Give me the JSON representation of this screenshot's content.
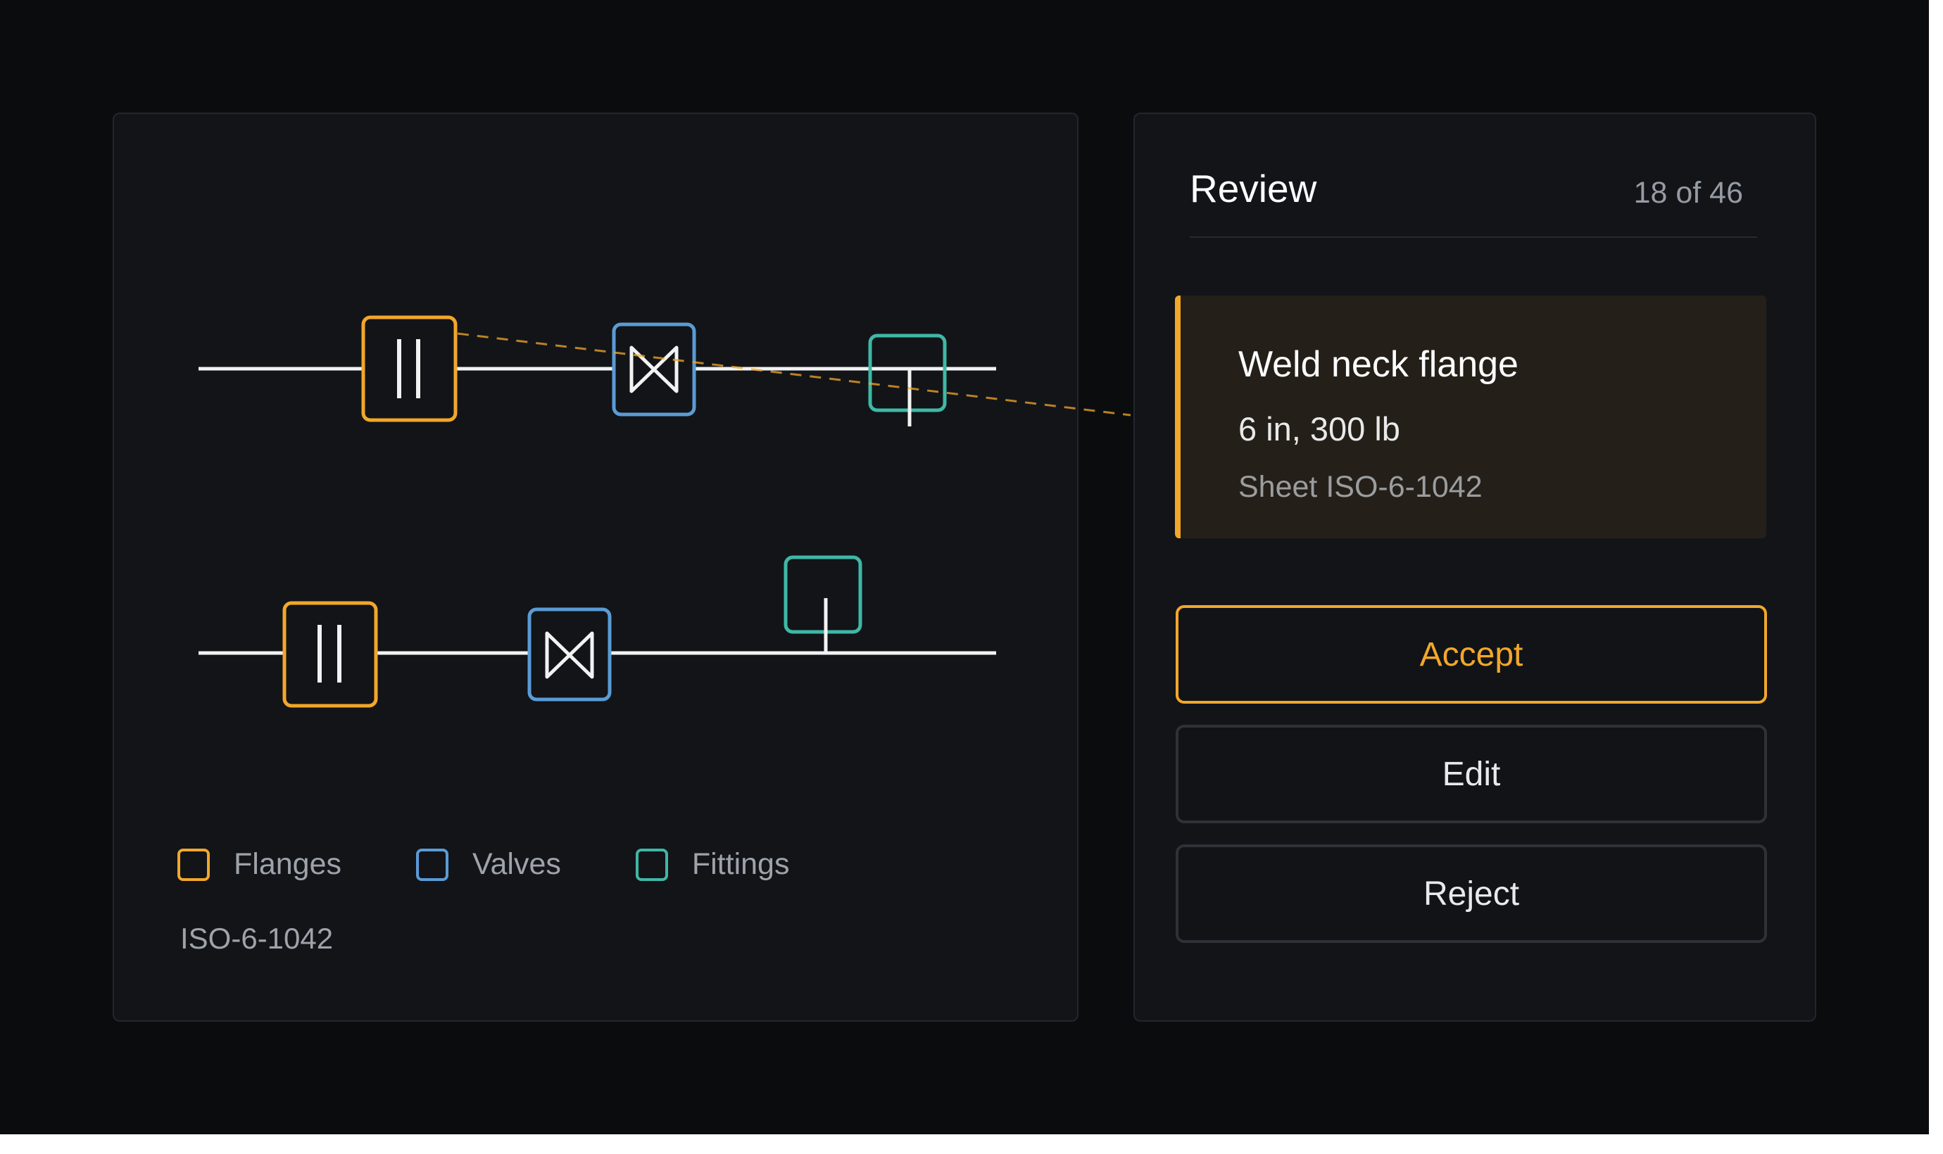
{
  "colors": {
    "flanges": "#f2a72a",
    "valves": "#5b9bd5",
    "fittings": "#3fb8a6",
    "pipe": "#f2f2f2",
    "background": "#0b0c0e",
    "panel": "#121418"
  },
  "drawing": {
    "legend": [
      {
        "label": "Flanges",
        "color": "#f2a72a"
      },
      {
        "label": "Valves",
        "color": "#5b9bd5"
      },
      {
        "label": "Fittings",
        "color": "#3fb8a6"
      }
    ],
    "sheet_id": "ISO-6-1042",
    "icons": [
      "flange-icon",
      "valve-icon",
      "tee-fitting-icon"
    ]
  },
  "review": {
    "title": "Review",
    "counter": "18 of 46",
    "item": {
      "name": "Weld neck flange",
      "spec": "6 in, 300 lb",
      "sheet": "Sheet ISO-6-1042"
    },
    "actions": {
      "accept": "Accept",
      "edit": "Edit",
      "reject": "Reject"
    }
  }
}
